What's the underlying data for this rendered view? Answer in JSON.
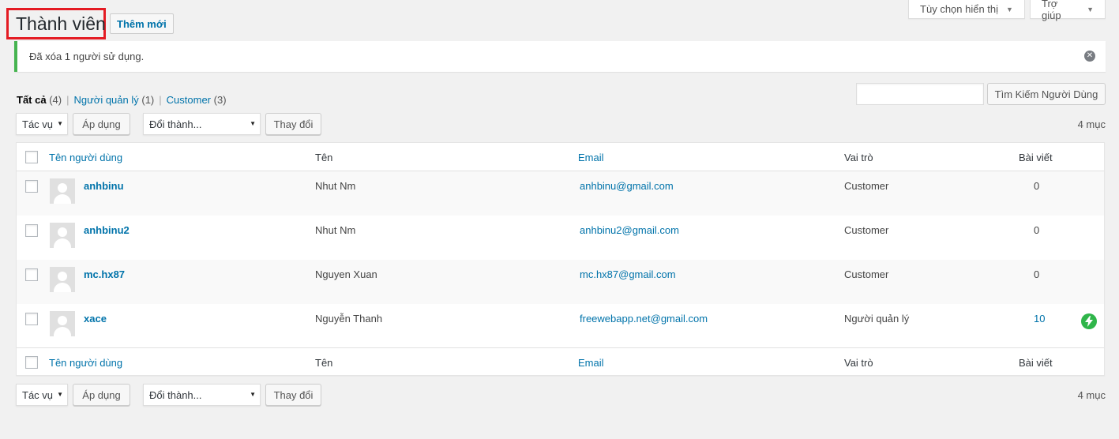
{
  "screen_meta": {
    "options_label": "Tùy chọn hiển thị",
    "help_label": "Trợ giúp"
  },
  "header": {
    "title": "Thành viên",
    "add_new_label": "Thêm mới"
  },
  "notice": {
    "message": "Đã xóa 1 người sử dụng."
  },
  "views": [
    {
      "label": "Tất cả",
      "count": "(4)"
    },
    {
      "label": "Người quản lý",
      "count": "(1)"
    },
    {
      "label": "Customer",
      "count": "(3)"
    }
  ],
  "search": {
    "value": "",
    "button_label": "Tìm Kiếm Người Dùng"
  },
  "tablenav": {
    "bulk_action": "Tác vụ",
    "apply_label": "Áp dụng",
    "change_role": "Đổi thành...",
    "change_label": "Thay đổi",
    "items_count": "4 mục"
  },
  "columns": {
    "username": "Tên người dùng",
    "name": "Tên",
    "email": "Email",
    "role": "Vai trò",
    "posts": "Bài viết"
  },
  "users": [
    {
      "username": "anhbinu",
      "name": "Nhut Nm",
      "email": "anhbinu@gmail.com",
      "role": "Customer",
      "posts": "0"
    },
    {
      "username": "anhbinu2",
      "name": "Nhut Nm",
      "email": "anhbinu2@gmail.com",
      "role": "Customer",
      "posts": "0"
    },
    {
      "username": "mc.hx87",
      "name": "Nguyen Xuan",
      "email": "mc.hx87@gmail.com",
      "role": "Customer",
      "posts": "0"
    },
    {
      "username": "xace",
      "name": "Nguyễn Thanh",
      "email": "freewebapp.net@gmail.com",
      "role": "Người quản lý",
      "posts": "10"
    }
  ],
  "colors": {
    "accent": "#0073aa",
    "notice_border": "#46b450",
    "highlight_box": "#e41b23",
    "bolt_badge": "#2fb54a"
  }
}
